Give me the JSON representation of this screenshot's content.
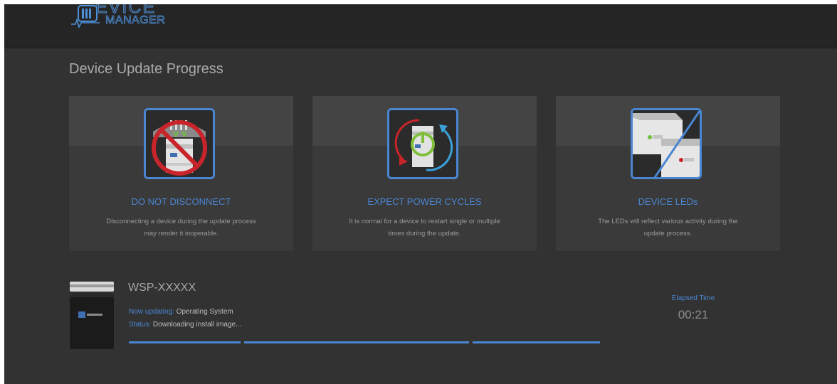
{
  "header": {
    "logo_line1": "EVICE",
    "logo_line2": "MANAGER"
  },
  "page": {
    "title": "Device Update Progress"
  },
  "cards": [
    {
      "icon": "no-disconnect-icon",
      "title": "DO NOT DISCONNECT",
      "desc_line1": "Disconnecting a device during the update process",
      "desc_line2": "may render it inoperable."
    },
    {
      "icon": "power-cycle-icon",
      "title": "EXPECT POWER CYCLES",
      "desc_line1": "It is normal for a device to restart single or multiple",
      "desc_line2": "times during the update."
    },
    {
      "icon": "device-leds-icon",
      "title": "DEVICE LEDs",
      "desc_line1": "The LEDs will reflect various activity during the",
      "desc_line2": "update process."
    }
  ],
  "device": {
    "name": "WSP-XXXXX",
    "now_updating_label": "Now updating:",
    "now_updating_value": "Operating System",
    "status_label": "Status:",
    "status_value": "Downloading install image...",
    "progress_segments": [
      1,
      1,
      1
    ]
  },
  "elapsed": {
    "label": "Elapsed Time",
    "value": "00:21"
  },
  "colors": {
    "accent": "#4a86d2",
    "background": "#323232",
    "topbar": "#252525"
  }
}
